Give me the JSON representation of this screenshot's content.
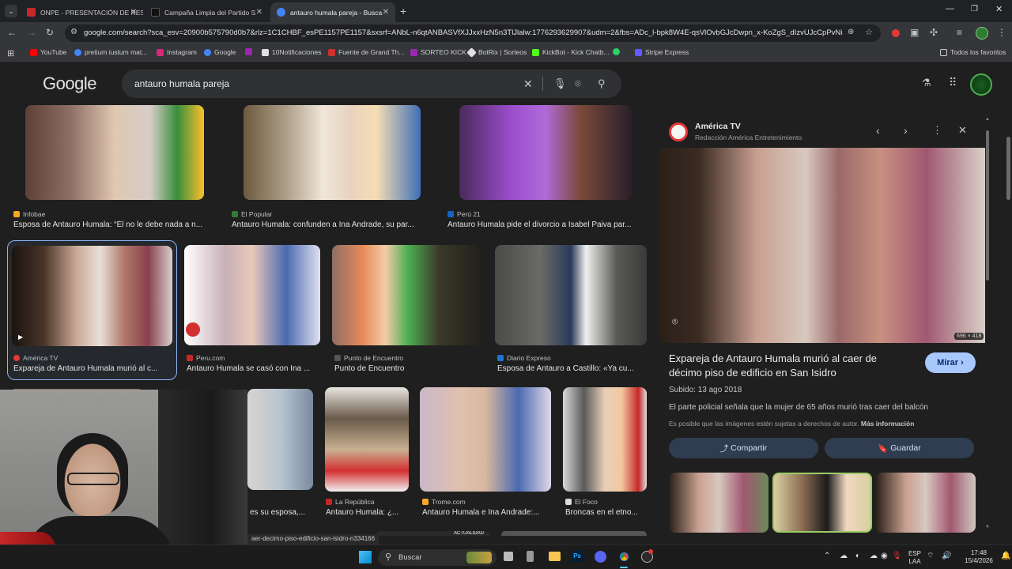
{
  "browser": {
    "tabs": [
      {
        "title": "ONPE - PRESENTACIÓN DE RES",
        "favicon_color": "#c62828"
      },
      {
        "title": "Campaña Limpia del Partido S",
        "favicon_color": "#111111"
      },
      {
        "title": "antauro humala pareja - Busca",
        "favicon_color": "#4285f4"
      }
    ],
    "url": "google.com/search?sca_esv=20900b575790d0b7&rlz=1C1CHBF_esPE1157PE1157&sxsrf=ANbL-n6qtANBASVfXJJxxHzN5n3TlJlalw:1776293629907&udm=2&fbs=ADc_l-bpk8W4E-qsVlOvbGJcDwpn_x-KoZgS_dIzvUJcCpPvNisF2DcSRPJ...",
    "bookmarks": [
      {
        "label": "YouTube",
        "color": "#ff0000"
      },
      {
        "label": "pretium iustum mat...",
        "color": "#4285f4"
      },
      {
        "label": "Instagram",
        "color": "#d62976"
      },
      {
        "label": "Google",
        "color": "#4285f4"
      },
      {
        "label": "",
        "color": "#9c27b0"
      },
      {
        "label": "10Notificaciones",
        "color": "#e0e0e0"
      },
      {
        "label": "Fuente de Grand Th...",
        "color": "#d32f2f"
      },
      {
        "label": "SORTEO KICK",
        "color": "#9c27b0"
      },
      {
        "label": "BotRix | Sorteos",
        "color": "#e0e0e0"
      },
      {
        "label": "KickBot - Kick Chatb...",
        "color": "#53fc18"
      },
      {
        "label": "",
        "color": "#25d366"
      },
      {
        "label": "Stripe Express",
        "color": "#635bff"
      }
    ],
    "all_bookmarks": "Todos los favoritos"
  },
  "search": {
    "logo": "Google",
    "query": "antauro humala pareja"
  },
  "results": [
    {
      "source": "Infobae",
      "title": "Esposa de Antauro Humala: “Él no le debe nada a n...",
      "favicon": "#f5a623"
    },
    {
      "source": "El Popular",
      "title": "Antauro Humala: confunden a Ina Andrade, su par...",
      "favicon": "#2e7d32"
    },
    {
      "source": "Perú 21",
      "title": "Antauro Humala pide el divorcio a Isabel Paiva par...",
      "favicon": "#1565c0"
    },
    {
      "source": "América TV",
      "title": "Expareja de Antauro Humala murió al c...",
      "favicon": "#e53935"
    },
    {
      "source": "Peru.com",
      "title": "Antauro Humala se casó con Ina ...",
      "favicon": "#c62828"
    },
    {
      "source": "Punto de Encuentro",
      "title": "Punto de Encuentro",
      "favicon": "#555555"
    },
    {
      "source": "Diario Expreso",
      "title": "Esposa de Antauro a Castillo: «Ya cu...",
      "favicon": "#1976d2"
    },
    {
      "source": "",
      "title": "es su esposa,...",
      "favicon": "#777777"
    },
    {
      "source": "La República",
      "title": "Antauro Humala: ¿...",
      "favicon": "#c62828"
    },
    {
      "source": "Trome.com",
      "title": "Antauro Humala e Ina Andrade:...",
      "favicon": "#f9a825"
    },
    {
      "source": "El Foco",
      "title": "Broncas en el etno...",
      "favicon": "#dddddd"
    }
  ],
  "panel": {
    "source_name": "América TV",
    "source_sub": "Redacción América Entretenimiento",
    "dimensions": "696 × 418",
    "title": "Expareja de Antauro Humala murió al caer de décimo piso de edificio en San Isidro",
    "visit_label": "Mirar",
    "date": "Subido: 13 ago 2018",
    "description": "El parte policial señala que la mujer de 65 años murió tras caer del balcón",
    "copyright_note": "Es posible que las imágenes estén sujetas a derechos de autor.",
    "more_info": "Más información",
    "share_label": "Compartir",
    "save_label": "Guardar"
  },
  "status_url": "aer-decimo-piso-edificio-san-isidro-n334166",
  "thumbnail_badge": "ACTUALIDAD",
  "taskbar": {
    "search_label": "Buscar",
    "lang": "ESP",
    "lang2": "LAA",
    "time": "17:48",
    "date": "15/4/2026"
  }
}
